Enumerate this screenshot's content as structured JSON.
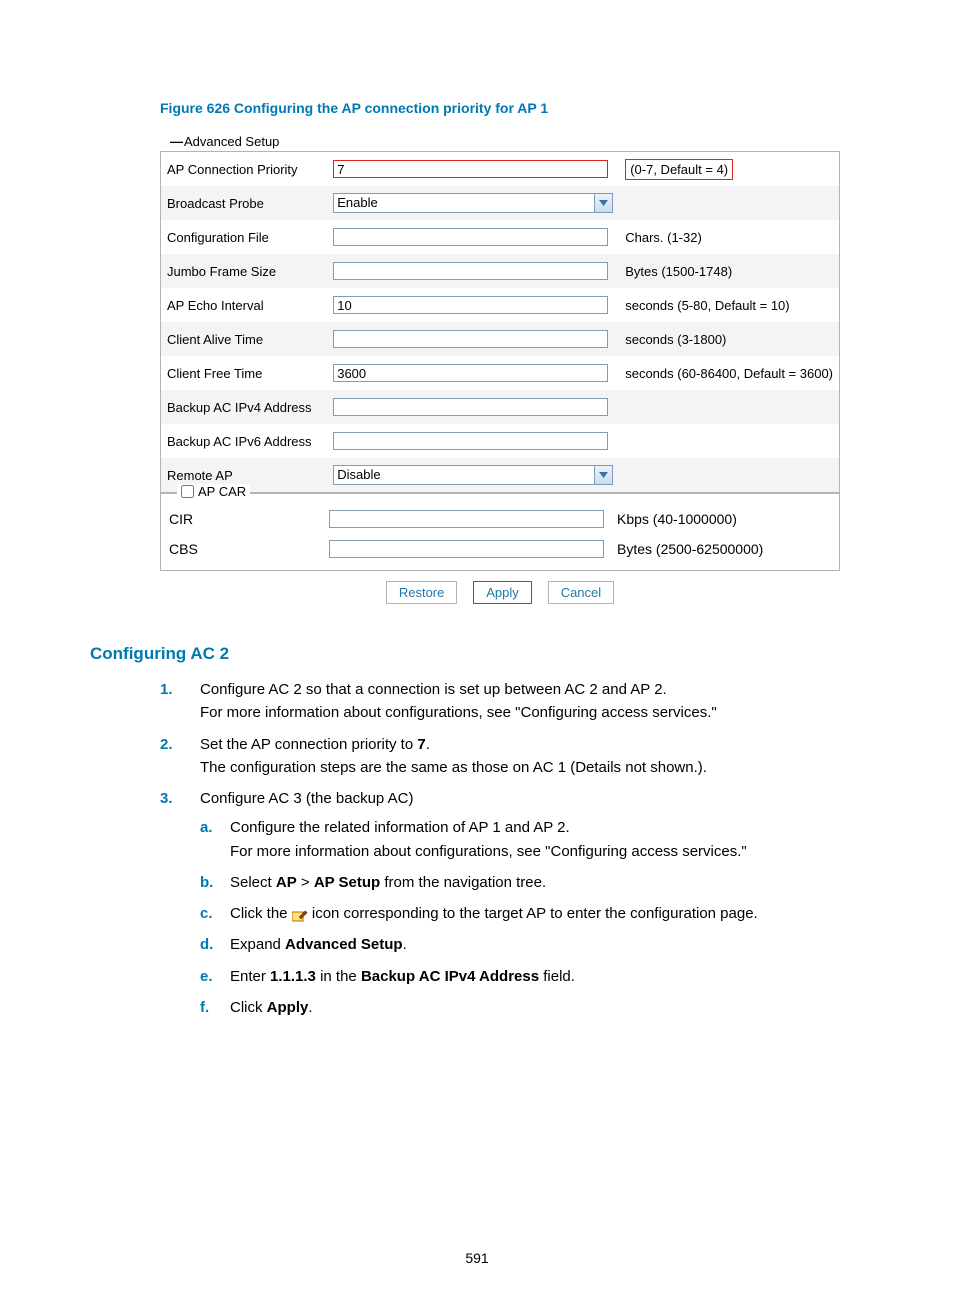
{
  "figure_caption": "Figure 626 Configuring the AP connection priority for AP 1",
  "adv_setup_label": "Advanced Setup",
  "form": {
    "rows": [
      {
        "label": "AP Connection Priority",
        "type": "text",
        "value": "7",
        "hint": "(0-7, Default = 4)",
        "highlight": true
      },
      {
        "label": "Broadcast Probe",
        "type": "select",
        "value": "Enable",
        "hint": ""
      },
      {
        "label": "Configuration File",
        "type": "text",
        "value": "",
        "hint": "Chars. (1-32)"
      },
      {
        "label": "Jumbo Frame Size",
        "type": "text",
        "value": "",
        "hint": "Bytes (1500-1748)"
      },
      {
        "label": "AP Echo Interval",
        "type": "text",
        "value": "10",
        "hint": "seconds (5-80, Default = 10)"
      },
      {
        "label": "Client Alive Time",
        "type": "text",
        "value": "",
        "hint": "seconds (3-1800)"
      },
      {
        "label": "Client Free Time",
        "type": "text",
        "value": "3600",
        "hint": "seconds (60-86400, Default = 3600)"
      },
      {
        "label": "Backup AC IPv4 Address",
        "type": "text",
        "value": "",
        "hint": ""
      },
      {
        "label": "Backup AC IPv6 Address",
        "type": "text",
        "value": "",
        "hint": ""
      },
      {
        "label": "Remote AP",
        "type": "select",
        "value": "Disable",
        "hint": ""
      }
    ],
    "ap_car": {
      "legend": "AP CAR",
      "cir": {
        "label": "CIR",
        "value": "",
        "hint": "Kbps (40-1000000)"
      },
      "cbs": {
        "label": "CBS",
        "value": "",
        "hint": "Bytes (2500-62500000)"
      }
    },
    "buttons": {
      "restore": "Restore",
      "apply": "Apply",
      "cancel": "Cancel"
    }
  },
  "section_heading": "Configuring AC 2",
  "steps": {
    "s1a": "Configure AC 2 so that a connection is set up between AC 2 and AP 2.",
    "s1b": "For more information about configurations, see \"Configuring access services.\"",
    "s2a_pre": "Set the AP connection priority to ",
    "s2a_bold": "7",
    "s2a_post": ".",
    "s2b": "The configuration steps are the same as those on AC 1 (Details not shown.).",
    "s3a": "Configure AC 3 (the backup AC)",
    "s3_a1": "Configure the related information of AP 1 and AP 2.",
    "s3_a2": "For more information about configurations, see \"Configuring access services.\"",
    "s3_b_pre": "Select ",
    "s3_b_b1": "AP",
    "s3_b_sep": " > ",
    "s3_b_b2": "AP Setup",
    "s3_b_post": " from the navigation tree.",
    "s3_c_pre": "Click the ",
    "s3_c_post": " icon corresponding to the target AP to enter the configuration page.",
    "s3_d_pre": "Expand ",
    "s3_d_bold": "Advanced Setup",
    "s3_d_post": ".",
    "s3_e_pre": "Enter ",
    "s3_e_b1": "1.1.1.3",
    "s3_e_mid": " in the ",
    "s3_e_b2": "Backup AC IPv4 Address",
    "s3_e_post": " field.",
    "s3_f_pre": "Click ",
    "s3_f_bold": "Apply",
    "s3_f_post": "."
  },
  "page_number": "591"
}
